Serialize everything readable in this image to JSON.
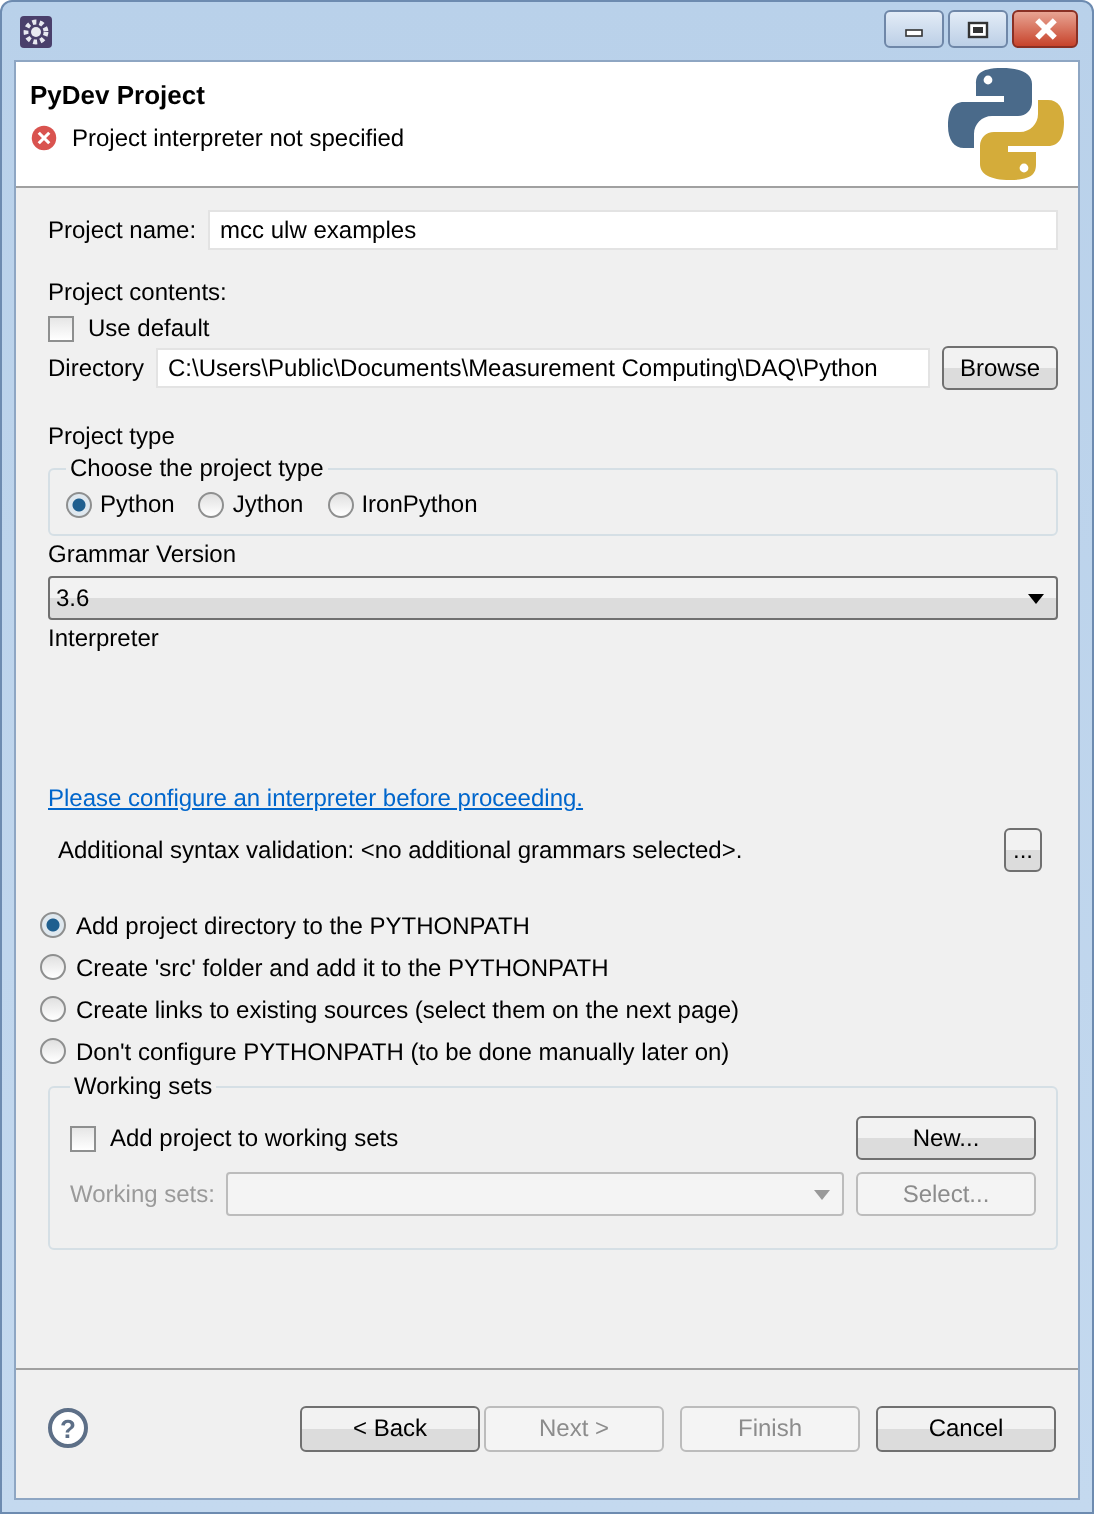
{
  "header": {
    "title": "PyDev Project",
    "message": "Project interpreter not specified",
    "error": true
  },
  "project_name": {
    "label": "Project name:",
    "value": "mcc ulw examples"
  },
  "project_contents": {
    "label": "Project contents:",
    "use_default": {
      "label": "Use default",
      "checked": false
    },
    "directory": {
      "label": "Directory",
      "value": "C:\\Users\\Public\\Documents\\Measurement Computing\\DAQ\\Python",
      "button": "Browse"
    }
  },
  "project_type": {
    "label": "Project type",
    "group_title": "Choose the project type",
    "options": [
      {
        "label": "Python",
        "selected": true
      },
      {
        "label": "Jython",
        "selected": false
      },
      {
        "label": "IronPython",
        "selected": false
      }
    ]
  },
  "grammar": {
    "label": "Grammar Version",
    "value": "3.6"
  },
  "interpreter": {
    "label": "Interpreter",
    "link": "Please configure an interpreter before proceeding."
  },
  "syntax_validation": {
    "text": "Additional syntax validation: <no additional grammars selected>.",
    "button": "..."
  },
  "pythonpath_options": [
    {
      "label": "Add project directory to the PYTHONPATH",
      "selected": true
    },
    {
      "label": "Create 'src' folder and add it to the PYTHONPATH",
      "selected": false
    },
    {
      "label": "Create links to existing sources (select them on the next page)",
      "selected": false
    },
    {
      "label": "Don't configure PYTHONPATH (to be done manually later on)",
      "selected": false
    }
  ],
  "working_sets": {
    "group_title": "Working sets",
    "add": {
      "label": "Add project to working sets",
      "checked": false
    },
    "new_button": "New...",
    "sets_label": "Working sets:",
    "disabled": true,
    "select_button": "Select..."
  },
  "footer": {
    "help": "?",
    "buttons": [
      {
        "label": "< Back",
        "disabled": false
      },
      {
        "label": "Next >",
        "disabled": true
      },
      {
        "label": "Finish",
        "disabled": true
      },
      {
        "label": "Cancel",
        "disabled": false
      }
    ]
  }
}
